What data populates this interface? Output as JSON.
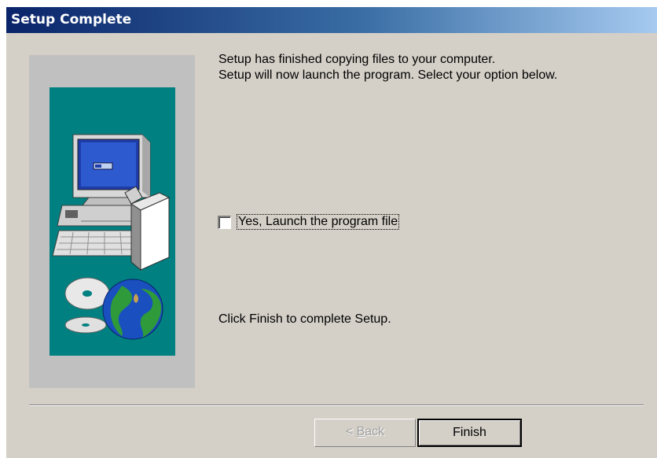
{
  "window": {
    "title": "Setup Complete"
  },
  "messages": {
    "line1": "Setup has finished copying files to your computer.",
    "line2": "Setup will now launch the program. Select your option below.",
    "finish_hint": "Click Finish to complete Setup."
  },
  "launch_option": {
    "label": "Yes, Launch the program file",
    "checked": false
  },
  "buttons": {
    "back_label_prefix": "< ",
    "back_label_mnemonic": "B",
    "back_label_rest": "ack",
    "back_enabled": false,
    "finish_label": "Finish"
  },
  "artwork": {
    "icon": "computer-with-globe-and-discs-icon",
    "colors": {
      "panel": "#008080",
      "frame": "#c0c0c0"
    }
  }
}
